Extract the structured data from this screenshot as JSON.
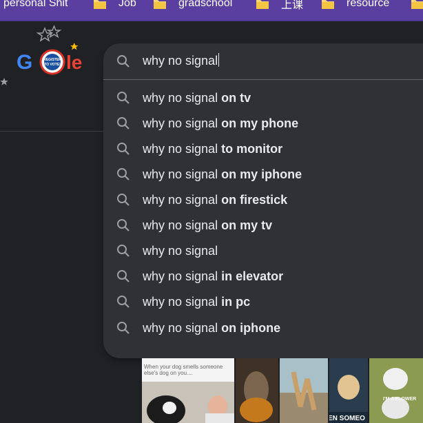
{
  "bookmarks": [
    {
      "label": "personal Shit",
      "icon": "folder-icon"
    },
    {
      "label": "Job",
      "icon": "folder-icon"
    },
    {
      "label": "gradschool",
      "icon": "folder-icon"
    },
    {
      "label": "上课",
      "icon": "folder-icon"
    },
    {
      "label": "resource",
      "icon": "folder-icon"
    }
  ],
  "logo": {
    "badge_line1": "REGISTER",
    "badge_line2": "TO VOTE!"
  },
  "search": {
    "query": "why no signal",
    "suggestions": [
      {
        "base": "why no signal",
        "suffix": "on tv"
      },
      {
        "base": "why no signal",
        "suffix": "on my phone"
      },
      {
        "base": "why no signal",
        "suffix": "to monitor"
      },
      {
        "base": "why no signal",
        "suffix": "on my iphone"
      },
      {
        "base": "why no signal",
        "suffix": "on firestick"
      },
      {
        "base": "why no signal",
        "suffix": "on my tv"
      },
      {
        "base": "why no signal",
        "suffix": ""
      },
      {
        "base": "why no signal",
        "suffix": "in elevator"
      },
      {
        "base": "why no signal",
        "suffix": "in pc"
      },
      {
        "base": "why no signal",
        "suffix": "on iphone"
      }
    ]
  },
  "images": {
    "caption_1": "When your dog smells someone else's dog on you....",
    "caption_5": "I'M A FLOWER",
    "caption_4": "EN SOMEO"
  },
  "colors": {
    "bookmark_bar": "#5a3fa0",
    "panel": "#303134",
    "background": "#202124",
    "text": "#e8eaed"
  }
}
